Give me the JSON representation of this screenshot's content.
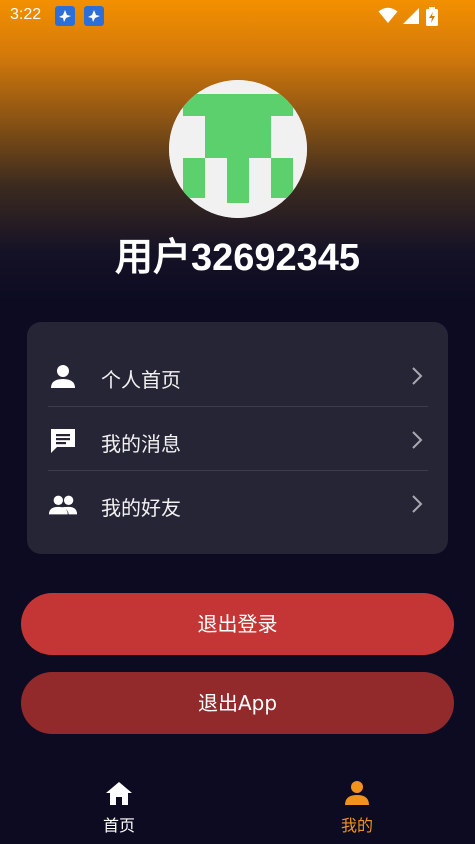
{
  "status_bar": {
    "time": "3:22",
    "notification_icons": [
      "bird-app-icon",
      "bird-app-icon"
    ],
    "system_icons": [
      "wifi-icon",
      "signal-icon",
      "battery-charging-icon"
    ]
  },
  "profile": {
    "avatar_icon": "identicon-avatar",
    "avatar_colors": [
      "#5bd06d",
      "#f1f1f1"
    ],
    "username": "用户32692345"
  },
  "menu": {
    "items": [
      {
        "label": "个人首页",
        "icon": "person-icon"
      },
      {
        "label": "我的消息",
        "icon": "message-icon"
      },
      {
        "label": "我的好友",
        "icon": "friends-icon"
      }
    ],
    "chevron_icon": "chevron-right-icon"
  },
  "actions": {
    "logout_label": "退出登录",
    "exit_app_label": "退出App"
  },
  "bottom_nav": {
    "items": [
      {
        "label": "首页",
        "icon": "home-icon",
        "active": false
      },
      {
        "label": "我的",
        "icon": "person-icon",
        "active": true
      }
    ]
  },
  "colors": {
    "header_gradient_top": "#f39000",
    "background": "#0d0b22",
    "card": "#262536",
    "logout_button": "#c43635",
    "exit_button": "#922a2b",
    "active_tab": "#f0921c"
  }
}
